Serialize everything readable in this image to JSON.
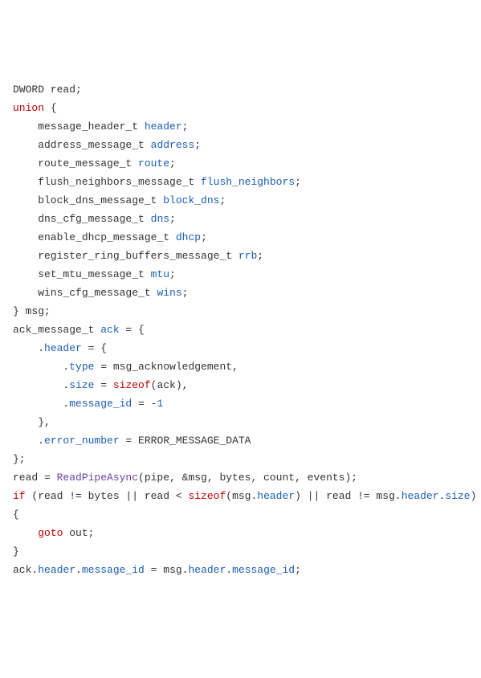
{
  "code": {
    "l1_t1": "DWORD read;",
    "l2_k1": "union",
    "l2_t1": " {",
    "l3_t1": "    message_header_t ",
    "l3_i1": "header",
    "l3_t2": ";",
    "l4_t1": "    address_message_t ",
    "l4_i1": "address",
    "l4_t2": ";",
    "l5_t1": "    route_message_t ",
    "l5_i1": "route",
    "l5_t2": ";",
    "l6_t1": "    flush_neighbors_message_t ",
    "l6_i1": "flush_neighbors",
    "l6_t2": ";",
    "l7_t1": "    block_dns_message_t ",
    "l7_i1": "block_dns",
    "l7_t2": ";",
    "l8_t1": "    dns_cfg_message_t ",
    "l8_i1": "dns",
    "l8_t2": ";",
    "l9_t1": "    enable_dhcp_message_t ",
    "l9_i1": "dhcp",
    "l9_t2": ";",
    "l10_t1": "    register_ring_buffers_message_t ",
    "l10_i1": "rrb",
    "l10_t2": ";",
    "l11_t1": "    set_mtu_message_t ",
    "l11_i1": "mtu",
    "l11_t2": ";",
    "l12_t1": "    wins_cfg_message_t ",
    "l12_i1": "wins",
    "l12_t2": ";",
    "l13_t1": "} msg;",
    "l14_t1": "ack_message_t ",
    "l14_i1": "ack",
    "l14_t2": " = {",
    "l15_t1": "    .",
    "l15_i1": "header",
    "l15_t2": " = {",
    "l16_t1": "        .",
    "l16_i1": "type",
    "l16_t2": " = msg_acknowledgement,",
    "l17_t1": "        .",
    "l17_i1": "size",
    "l17_t2": " = ",
    "l17_k1": "sizeof",
    "l17_t3": "(ack),",
    "l18_t1": "        .",
    "l18_i1": "message_id",
    "l18_t2": " = -",
    "l18_n1": "1",
    "l19_t1": "    },",
    "l20_t1": "    .",
    "l20_i1": "error_number",
    "l20_t2": " = ERROR_MESSAGE_DATA",
    "l21_t1": "};",
    "l22_t1": "",
    "l23_t1": "read = ",
    "l23_f1": "ReadPipeAsync",
    "l23_t2": "(pipe, &msg, bytes, count, events);",
    "l24_k1": "if",
    "l24_t1": " (read != bytes || read < ",
    "l24_k2": "sizeof",
    "l24_t2": "(msg.",
    "l24_i1": "header",
    "l24_t3": ") || read != msg.",
    "l24_i2": "header",
    "l24_t4": ".",
    "l24_i3": "size",
    "l24_t5": ")",
    "l25_t1": "{",
    "l26_t1": "    ",
    "l26_k1": "goto",
    "l26_t2": " out;",
    "l27_t1": "}",
    "l28_t1": "",
    "l29_t1": "ack.",
    "l29_i1": "header",
    "l29_t2": ".",
    "l29_i2": "message_id",
    "l29_t3": " = msg.",
    "l29_i3": "header",
    "l29_t4": ".",
    "l29_i4": "message_id",
    "l29_t5": ";"
  }
}
